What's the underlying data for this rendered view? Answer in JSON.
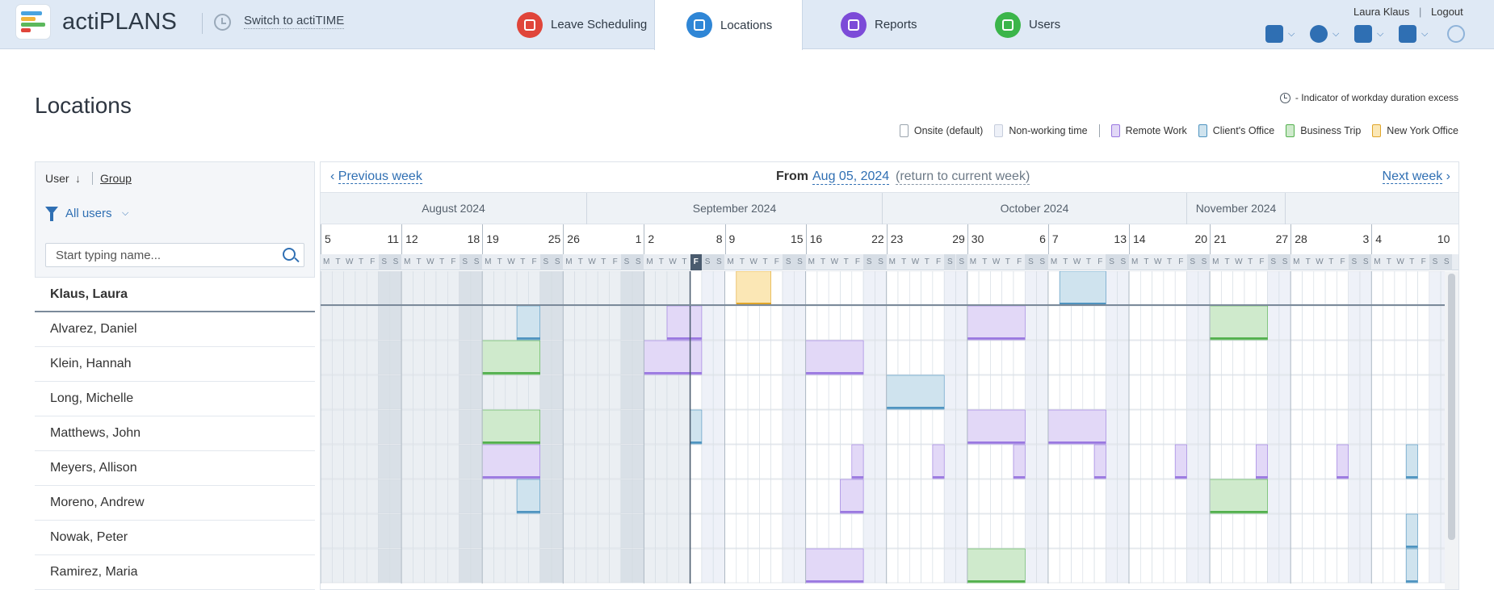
{
  "header": {
    "brand": "actiPLANS",
    "switch_label": "Switch to actiTIME",
    "tabs": [
      {
        "label": "Leave Scheduling",
        "icon": "leave-scheduling-icon",
        "color": "#e0453a",
        "active": false
      },
      {
        "label": "Locations",
        "icon": "locations-icon",
        "color": "#2f86d6",
        "active": true
      },
      {
        "label": "Reports",
        "icon": "reports-icon",
        "color": "#7c4bd8",
        "active": false
      },
      {
        "label": "Users",
        "icon": "users-icon",
        "color": "#3bb54a",
        "active": false
      }
    ],
    "user_name": "Laura Klaus",
    "separator": "|",
    "logout": "Logout",
    "tools": [
      "calendar-icon",
      "gear-icon",
      "puzzle-icon",
      "help-icon",
      "lightbulb-icon"
    ]
  },
  "page": {
    "title": "Locations",
    "indicator_text": "- Indicator of workday duration excess",
    "legend": [
      {
        "label": "Onsite (default)",
        "color": "#ffffff",
        "border": "#9aa4ad"
      },
      {
        "label": "Non-working time",
        "color": "#eef1f8",
        "border": "#c6cddc"
      },
      {
        "label": "Remote Work",
        "color": "#e2d8f7",
        "border": "#9a78e0"
      },
      {
        "label": "Client's Office",
        "color": "#cfe3ee",
        "border": "#4f94c0"
      },
      {
        "label": "Business Trip",
        "color": "#cfeacc",
        "border": "#52b04d"
      },
      {
        "label": "New York Office",
        "color": "#fbe7b5",
        "border": "#e0a52a"
      }
    ]
  },
  "left_panel": {
    "sort_user": "User",
    "sort_group": "Group",
    "filter_label": "All users",
    "search_placeholder": "Start typing name..."
  },
  "users": [
    "Klaus, Laura",
    "Alvarez, Daniel",
    "Klein, Hannah",
    "Long, Michelle",
    "Matthews, John",
    "Meyers, Allison",
    "Moreno, Andrew",
    "Nowak, Peter",
    "Ramirez, Maria"
  ],
  "timeline": {
    "prev_label": "Previous week",
    "next_label": "Next week",
    "from_label": "From",
    "from_date": "Aug 05, 2024",
    "return_label": "(return to current week)",
    "months": [
      "August 2024",
      "September 2024",
      "October 2024",
      "November 2024"
    ],
    "weeks": [
      {
        "start": "5",
        "end": "11"
      },
      {
        "start": "12",
        "end": "18"
      },
      {
        "start": "19",
        "end": "25"
      },
      {
        "start": "26",
        "end": "1"
      },
      {
        "start": "2",
        "end": "8"
      },
      {
        "start": "9",
        "end": "15"
      },
      {
        "start": "16",
        "end": "22"
      },
      {
        "start": "23",
        "end": "29"
      },
      {
        "start": "30",
        "end": "6"
      },
      {
        "start": "7",
        "end": "13"
      },
      {
        "start": "14",
        "end": "20"
      },
      {
        "start": "21",
        "end": "27"
      },
      {
        "start": "28",
        "end": "3"
      },
      {
        "start": "4",
        "end": "10"
      }
    ],
    "day_letters": [
      "M",
      "T",
      "W",
      "T",
      "F",
      "S",
      "S"
    ],
    "today_index": 32,
    "location_blocks": [
      {
        "user": 0,
        "from": 36,
        "to": 38,
        "loc": "New York Office"
      },
      {
        "user": 0,
        "from": 64,
        "to": 67,
        "loc": "Client's Office"
      },
      {
        "user": 1,
        "from": 17,
        "to": 18,
        "loc": "Client's Office"
      },
      {
        "user": 1,
        "from": 30,
        "to": 32,
        "loc": "Remote Work"
      },
      {
        "user": 1,
        "from": 56,
        "to": 60,
        "loc": "Remote Work"
      },
      {
        "user": 1,
        "from": 77,
        "to": 81,
        "loc": "Business Trip"
      },
      {
        "user": 2,
        "from": 14,
        "to": 18,
        "loc": "Business Trip"
      },
      {
        "user": 2,
        "from": 28,
        "to": 32,
        "loc": "Remote Work"
      },
      {
        "user": 2,
        "from": 42,
        "to": 46,
        "loc": "Remote Work"
      },
      {
        "user": 3,
        "from": 49,
        "to": 53,
        "loc": "Client's Office"
      },
      {
        "user": 4,
        "from": 14,
        "to": 18,
        "loc": "Business Trip"
      },
      {
        "user": 4,
        "from": 32,
        "to": 32,
        "loc": "Client's Office"
      },
      {
        "user": 4,
        "from": 56,
        "to": 60,
        "loc": "Remote Work"
      },
      {
        "user": 4,
        "from": 63,
        "to": 67,
        "loc": "Remote Work"
      },
      {
        "user": 5,
        "from": 14,
        "to": 18,
        "loc": "Remote Work"
      },
      {
        "user": 5,
        "from": 46,
        "to": 46,
        "loc": "Remote Work"
      },
      {
        "user": 5,
        "from": 53,
        "to": 53,
        "loc": "Remote Work"
      },
      {
        "user": 5,
        "from": 60,
        "to": 60,
        "loc": "Remote Work"
      },
      {
        "user": 5,
        "from": 67,
        "to": 67,
        "loc": "Remote Work"
      },
      {
        "user": 5,
        "from": 74,
        "to": 74,
        "loc": "Remote Work"
      },
      {
        "user": 5,
        "from": 81,
        "to": 81,
        "loc": "Remote Work"
      },
      {
        "user": 5,
        "from": 88,
        "to": 88,
        "loc": "Remote Work"
      },
      {
        "user": 5,
        "from": 94,
        "to": 94,
        "loc": "Client's Office"
      },
      {
        "user": 6,
        "from": 17,
        "to": 18,
        "loc": "Client's Office"
      },
      {
        "user": 6,
        "from": 45,
        "to": 46,
        "loc": "Remote Work"
      },
      {
        "user": 6,
        "from": 77,
        "to": 81,
        "loc": "Business Trip"
      },
      {
        "user": 7,
        "from": 94,
        "to": 94,
        "loc": "Client's Office"
      },
      {
        "user": 8,
        "from": 42,
        "to": 46,
        "loc": "Remote Work"
      },
      {
        "user": 8,
        "from": 56,
        "to": 60,
        "loc": "Business Trip"
      },
      {
        "user": 8,
        "from": 94,
        "to": 94,
        "loc": "Client's Office"
      }
    ]
  }
}
